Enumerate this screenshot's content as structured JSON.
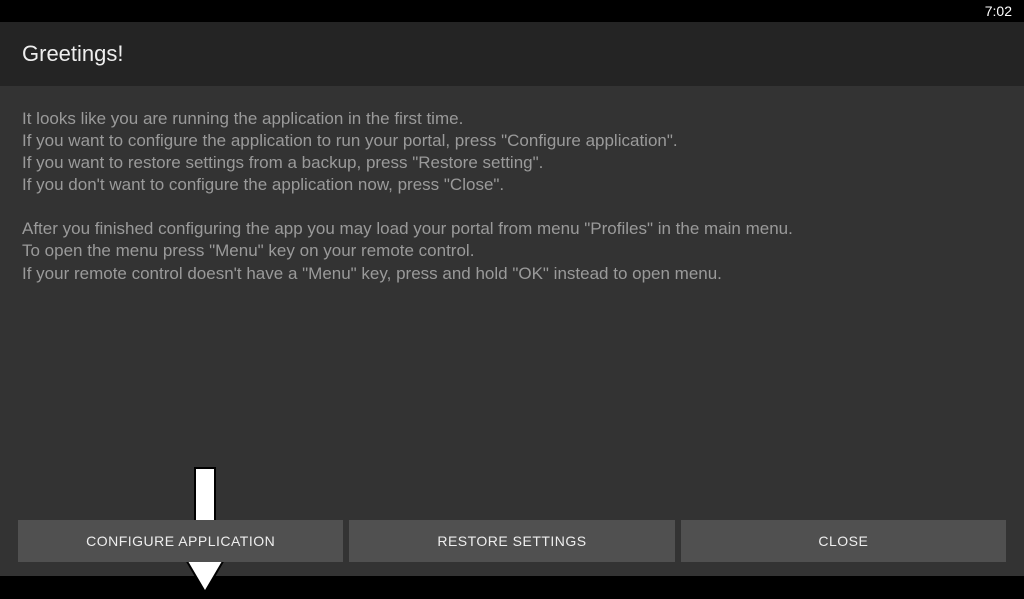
{
  "status": {
    "time": "7:02"
  },
  "header": {
    "title": "Greetings!"
  },
  "content": {
    "p1_line1": "It looks like you are running the application in the first time.",
    "p1_line2": " If you want to configure the application to run your portal, press \"Configure application\".",
    "p1_line3": " If you want to restore settings from a backup, press \"Restore setting\".",
    "p1_line4": " If you don't want to configure the application now, press \"Close\".",
    "p2_line1": "After you finished configuring the app you may load your portal from menu \"Profiles\" in the main menu.",
    "p2_line2": "To open the menu press \"Menu\" key on your remote control.",
    "p2_line3": "If your remote control doesn't have a \"Menu\" key, press and hold \"OK\" instead to open menu."
  },
  "buttons": {
    "configure": "CONFIGURE APPLICATION",
    "restore": "RESTORE SETTINGS",
    "close": "CLOSE"
  }
}
